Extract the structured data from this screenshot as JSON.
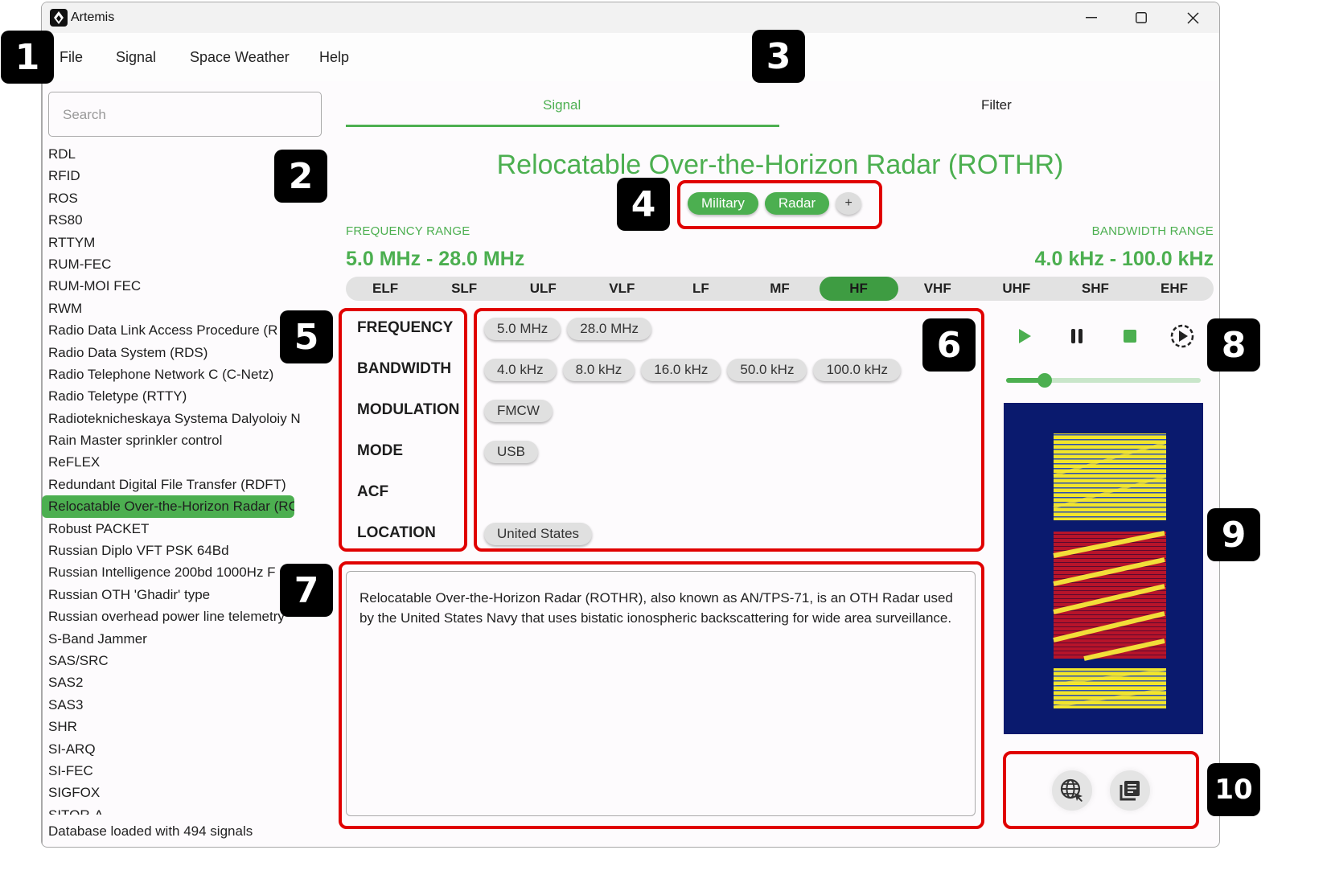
{
  "window": {
    "title": "Artemis",
    "controls": [
      "minimize-icon",
      "maximize-icon",
      "close-icon"
    ]
  },
  "menu": {
    "items": [
      "File",
      "Signal",
      "Space Weather",
      "Help"
    ]
  },
  "sidebar": {
    "search_placeholder": "Search",
    "search_value": "",
    "items": [
      "RDL",
      "RFID",
      "ROS",
      "RS80",
      "RTTYM",
      "RUM-FEC",
      "RUM-MOI FEC",
      "RWM",
      "Radio Data Link Access Procedure (R",
      "Radio Data System (RDS)",
      "Radio Telephone Network C (C-Netz)",
      "Radio Teletype (RTTY)",
      "Radioteknicheskaya Systema Dalyoloiy N",
      "Rain Master sprinkler control",
      "ReFLEX",
      "Redundant Digital File Transfer (RDFT)",
      "Relocatable Over-the-Horizon Radar (RC",
      "Robust PACKET",
      "Russian Diplo VFT PSK 64Bd",
      "Russian Intelligence 200bd 1000Hz F",
      "Russian OTH 'Ghadir' type",
      "Russian overhead power line telemetry",
      "S-Band Jammer",
      "SAS/SRC",
      "SAS2",
      "SAS3",
      "SHR",
      "SI-ARQ",
      "SI-FEC",
      "SIGFOX",
      "SITOR-A"
    ],
    "selected_index": 16,
    "status": "Database loaded with 494 signals"
  },
  "tabs": [
    {
      "label": "Signal",
      "active": true
    },
    {
      "label": "Filter",
      "active": false
    }
  ],
  "signal": {
    "title": "Relocatable Over-the-Horizon Radar (ROTHR)",
    "categories": [
      "Military",
      "Radar"
    ],
    "add_category_label": "+",
    "frequency_range_label": "FREQUENCY RANGE",
    "frequency_range_value": "5.0 MHz - 28.0 MHz",
    "bandwidth_range_label": "BANDWIDTH RANGE",
    "bandwidth_range_value": "4.0 kHz - 100.0 kHz",
    "bands": [
      "ELF",
      "SLF",
      "ULF",
      "VLF",
      "LF",
      "MF",
      "HF",
      "VHF",
      "UHF",
      "SHF",
      "EHF"
    ],
    "active_band": "HF",
    "properties": [
      {
        "label": "FREQUENCY",
        "values": [
          "5.0 MHz",
          "28.0 MHz"
        ]
      },
      {
        "label": "BANDWIDTH",
        "values": [
          "4.0 kHz",
          "8.0 kHz",
          "16.0 kHz",
          "50.0 kHz",
          "100.0 kHz"
        ]
      },
      {
        "label": "MODULATION",
        "values": [
          "FMCW"
        ]
      },
      {
        "label": "MODE",
        "values": [
          "USB"
        ]
      },
      {
        "label": "ACF",
        "values": []
      },
      {
        "label": "LOCATION",
        "values": [
          "United States"
        ]
      }
    ],
    "description": "Relocatable Over-the-Horizon Radar (ROTHR), also known as AN/TPS-71, is an OTH Radar used by the United States Navy that uses bistatic ionospheric backscattering for wide area surveillance."
  },
  "player": {
    "controls": [
      "play-icon",
      "pause-icon",
      "stop-icon",
      "loop-play-icon"
    ],
    "volume": 0.2
  },
  "actions": [
    "web-link-icon",
    "library-icon"
  ],
  "annotations": [
    "1",
    "2",
    "3",
    "4",
    "5",
    "6",
    "7",
    "8",
    "9",
    "10"
  ],
  "colors": {
    "accent": "#4caf50",
    "accent_dark": "#3e9c42",
    "chip_grey": "#e0e0e0",
    "highlight_box": "#e00000",
    "waterfall_bg": "#0a1a6e"
  }
}
